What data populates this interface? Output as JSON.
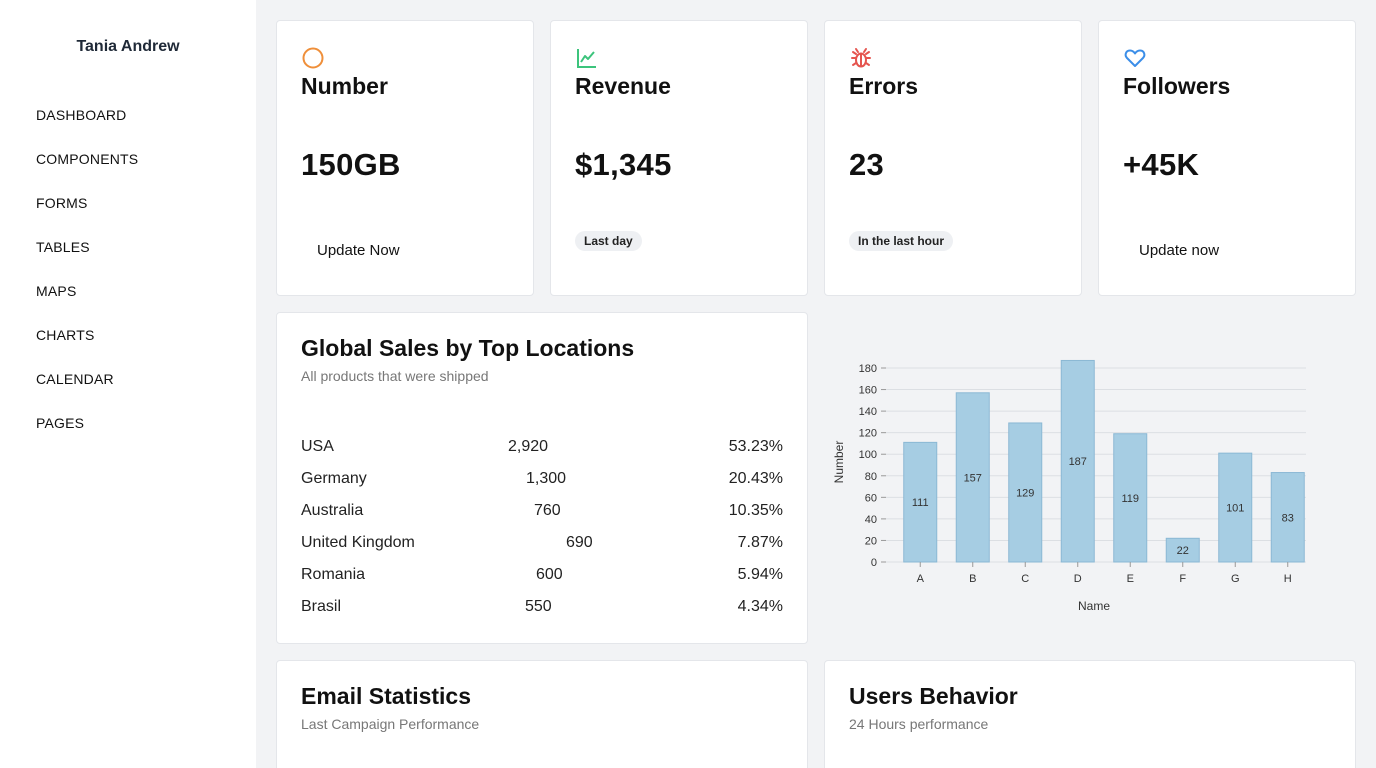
{
  "sidebar": {
    "user_name": "Tania Andrew",
    "items": [
      {
        "label": "DASHBOARD"
      },
      {
        "label": "COMPONENTS"
      },
      {
        "label": "FORMS"
      },
      {
        "label": "TABLES"
      },
      {
        "label": "MAPS"
      },
      {
        "label": "CHARTS"
      },
      {
        "label": "CALENDAR"
      },
      {
        "label": "PAGES"
      }
    ]
  },
  "stats": [
    {
      "icon": "circle-icon",
      "icon_color": "#ef8f3a",
      "title": "Number",
      "value": "150GB",
      "action": "Update Now"
    },
    {
      "icon": "line-chart-icon",
      "icon_color": "#3cc47c",
      "title": "Revenue",
      "value": "$1,345",
      "badge": "Last day"
    },
    {
      "icon": "bug-icon",
      "icon_color": "#e5554f",
      "title": "Errors",
      "value": "23",
      "badge": "In the last hour"
    },
    {
      "icon": "heart-icon",
      "icon_color": "#3b8ee8",
      "title": "Followers",
      "value": "+45K",
      "action": "Update now"
    }
  ],
  "sales": {
    "title": "Global Sales by Top Locations",
    "subtitle": "All products that were shipped",
    "rows": [
      {
        "country": "USA",
        "sales": "2,920",
        "percent": "53.23%"
      },
      {
        "country": "Germany",
        "sales": "1,300",
        "percent": "20.43%"
      },
      {
        "country": "Australia",
        "sales": "760",
        "percent": "10.35%"
      },
      {
        "country": "United Kingdom",
        "sales": "690",
        "percent": "7.87%"
      },
      {
        "country": "Romania",
        "sales": "600",
        "percent": "5.94%"
      },
      {
        "country": "Brasil",
        "sales": "550",
        "percent": "4.34%"
      }
    ]
  },
  "chart_data": {
    "type": "bar",
    "categories": [
      "A",
      "B",
      "C",
      "D",
      "E",
      "F",
      "G",
      "H"
    ],
    "values": [
      111,
      157,
      129,
      187,
      119,
      22,
      101,
      83
    ],
    "xlabel": "Name",
    "ylabel": "Number",
    "ylim": [
      0,
      180
    ],
    "yticks": [
      0,
      20,
      40,
      60,
      80,
      100,
      120,
      140,
      160,
      180
    ],
    "grid": true,
    "bar_color": "#a6cde3",
    "bar_border": "#8bb8d4"
  },
  "email": {
    "title": "Email Statistics",
    "subtitle": "Last Campaign Performance"
  },
  "behavior": {
    "title": "Users Behavior",
    "subtitle": "24 Hours performance"
  }
}
